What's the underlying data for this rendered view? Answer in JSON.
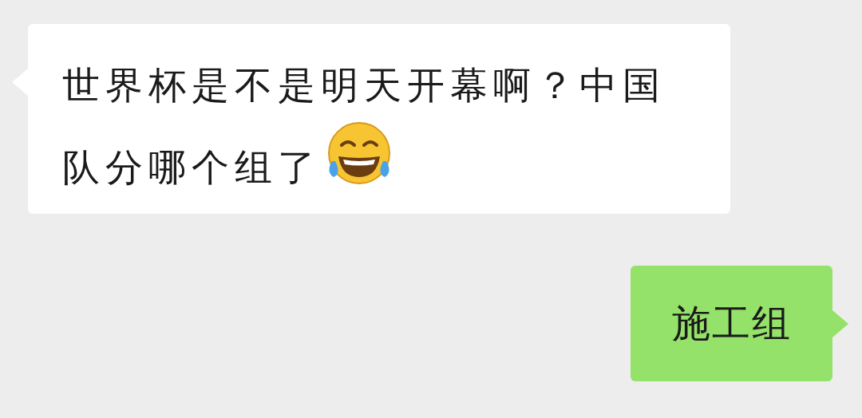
{
  "messages": [
    {
      "kind": "incoming",
      "text": "世界杯是不是明天开幕啊？中国队分哪个组了",
      "emoji": true
    },
    {
      "kind": "outgoing",
      "text": "施工组",
      "emoji": false
    }
  ]
}
